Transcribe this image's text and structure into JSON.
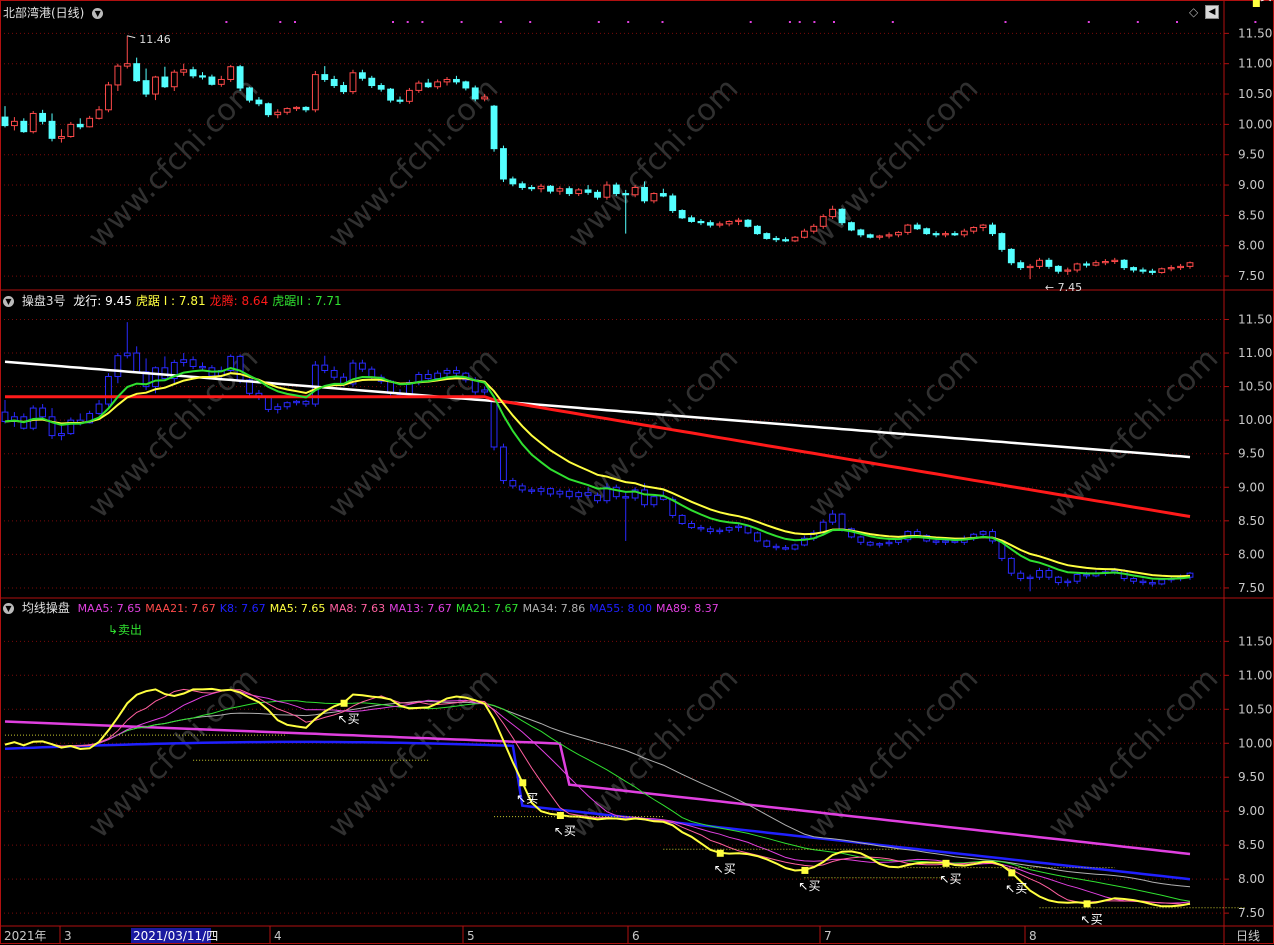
{
  "colors": {
    "bg": "#000000",
    "frame": "#b01010",
    "grid": "#7a0a0a",
    "axisText": "#c8c8c8",
    "upCandle": "#ff4a4a",
    "downCandle": "#54ffff",
    "blueCandle": "#2a2aff",
    "white": "#ffffff",
    "red": "#ff1a1a",
    "yellow": "#ffff40",
    "green": "#30e030",
    "magenta": "#e040e0",
    "blue": "#2020ff",
    "pink": "#ff60a0",
    "gray": "#b0b0b0"
  },
  "icons": [
    "collapse-icon",
    "diamond-icon",
    "scroll-left-icon"
  ],
  "panel1": {
    "title": "北部湾港(日线)",
    "yTicks": [
      "11.50",
      "11.00",
      "10.50",
      "10.00",
      "9.50",
      "9.00",
      "8.50",
      "8.00",
      "7.50"
    ],
    "ylim": [
      7.32,
      11.72
    ],
    "highLabel": "11.46",
    "lowLabel": "7.45"
  },
  "panel2": {
    "title": "操盘3号",
    "legend": [
      {
        "label": "龙行: 9.45",
        "color": "#ffffff"
      },
      {
        "label": "虎踞 I : 7.81",
        "color": "#ffff40"
      },
      {
        "label": "龙腾: 8.64",
        "color": "#ff1a1a"
      },
      {
        "label": "虎踞II : 7.71",
        "color": "#30e030"
      }
    ],
    "yTicks": [
      "11.50",
      "11.00",
      "10.50",
      "10.00",
      "9.50",
      "9.00",
      "8.50",
      "8.00",
      "7.50"
    ],
    "ylim": [
      7.38,
      11.82
    ]
  },
  "panel3": {
    "title": "均线操盘",
    "legend": [
      {
        "label": "MAA5: 7.65",
        "color": "#e040e0"
      },
      {
        "label": "MAA21: 7.67",
        "color": "#ff4a4a"
      },
      {
        "label": "K8: 7.67",
        "color": "#2020ff"
      },
      {
        "label": "MA5: 7.65",
        "color": "#ffff40"
      },
      {
        "label": "MA8: 7.63",
        "color": "#ff60a0"
      },
      {
        "label": "MA13: 7.67",
        "color": "#e040e0"
      },
      {
        "label": "MA21: 7.67",
        "color": "#30e030"
      },
      {
        "label": "MA34: 7.86",
        "color": "#b0b0b0"
      },
      {
        "label": "MA55: 8.00",
        "color": "#2020ff"
      },
      {
        "label": "MA89: 8.37",
        "color": "#e040e0"
      }
    ],
    "yTicks": [
      "11.50",
      "11.00",
      "10.50",
      "10.00",
      "9.50",
      "9.00",
      "8.50",
      "8.00",
      "7.50"
    ],
    "ylim": [
      7.34,
      12.02
    ],
    "sellLabel": "卖出",
    "buyLabel": "↖买"
  },
  "xAxis": {
    "labels": [
      {
        "text": "2021年",
        "x": 0
      },
      {
        "text": "3",
        "x": 60
      },
      {
        "text": "4",
        "x": 270
      },
      {
        "text": "5",
        "x": 463
      },
      {
        "text": "6",
        "x": 628
      },
      {
        "text": "7",
        "x": 820
      },
      {
        "text": "8",
        "x": 1025
      }
    ],
    "cursorDate": "2021/03/11/四",
    "period": "日线"
  },
  "watermark": "www.cfchi.com",
  "chart_data": {
    "type": "candlestick",
    "title": "北部湾港(日线)",
    "ohlc": [
      [
        10.12,
        10.3,
        9.95,
        9.98
      ],
      [
        9.98,
        10.12,
        9.9,
        10.05
      ],
      [
        10.05,
        10.1,
        9.86,
        9.88
      ],
      [
        9.88,
        10.22,
        9.85,
        10.18
      ],
      [
        10.18,
        10.24,
        10.0,
        10.05
      ],
      [
        10.05,
        10.18,
        9.72,
        9.77
      ],
      [
        9.77,
        9.92,
        9.7,
        9.8
      ],
      [
        9.8,
        10.04,
        9.78,
        10.0
      ],
      [
        10.0,
        10.1,
        9.92,
        9.96
      ],
      [
        9.96,
        10.14,
        9.95,
        10.1
      ],
      [
        10.1,
        10.3,
        10.08,
        10.24
      ],
      [
        10.24,
        10.7,
        10.2,
        10.65
      ],
      [
        10.65,
        11.0,
        10.55,
        10.96
      ],
      [
        10.96,
        11.46,
        10.92,
        11.0
      ],
      [
        11.0,
        11.1,
        10.7,
        10.72
      ],
      [
        10.72,
        10.92,
        10.45,
        10.5
      ],
      [
        10.5,
        10.8,
        10.4,
        10.78
      ],
      [
        10.78,
        10.95,
        10.6,
        10.62
      ],
      [
        10.62,
        10.9,
        10.55,
        10.86
      ],
      [
        10.86,
        11.0,
        10.8,
        10.9
      ],
      [
        10.9,
        10.95,
        10.76,
        10.8
      ],
      [
        10.8,
        10.86,
        10.74,
        10.78
      ],
      [
        10.78,
        10.82,
        10.64,
        10.66
      ],
      [
        10.66,
        10.8,
        10.62,
        10.74
      ],
      [
        10.74,
        10.98,
        10.7,
        10.95
      ],
      [
        10.95,
        10.98,
        10.55,
        10.6
      ],
      [
        10.6,
        10.62,
        10.36,
        10.4
      ],
      [
        10.4,
        10.45,
        10.3,
        10.34
      ],
      [
        10.34,
        10.36,
        10.12,
        10.16
      ],
      [
        10.16,
        10.25,
        10.1,
        10.2
      ],
      [
        10.2,
        10.28,
        10.16,
        10.26
      ],
      [
        10.26,
        10.3,
        10.22,
        10.28
      ],
      [
        10.28,
        10.3,
        10.2,
        10.24
      ],
      [
        10.24,
        10.88,
        10.2,
        10.82
      ],
      [
        10.82,
        10.96,
        10.7,
        10.74
      ],
      [
        10.74,
        10.8,
        10.6,
        10.64
      ],
      [
        10.64,
        10.7,
        10.5,
        10.54
      ],
      [
        10.54,
        10.9,
        10.5,
        10.85
      ],
      [
        10.85,
        10.9,
        10.72,
        10.76
      ],
      [
        10.76,
        10.8,
        10.6,
        10.64
      ],
      [
        10.64,
        10.68,
        10.54,
        10.58
      ],
      [
        10.58,
        10.6,
        10.36,
        10.4
      ],
      [
        10.4,
        10.46,
        10.34,
        10.38
      ],
      [
        10.38,
        10.6,
        10.34,
        10.56
      ],
      [
        10.56,
        10.72,
        10.52,
        10.68
      ],
      [
        10.68,
        10.75,
        10.6,
        10.62
      ],
      [
        10.62,
        10.74,
        10.58,
        10.7
      ],
      [
        10.7,
        10.78,
        10.64,
        10.74
      ],
      [
        10.74,
        10.8,
        10.66,
        10.7
      ],
      [
        10.7,
        10.72,
        10.56,
        10.6
      ],
      [
        10.6,
        10.64,
        10.38,
        10.42
      ],
      [
        10.42,
        10.5,
        10.38,
        10.45
      ],
      [
        10.3,
        10.32,
        9.55,
        9.6
      ],
      [
        9.6,
        9.65,
        9.05,
        9.1
      ],
      [
        9.1,
        9.14,
        8.98,
        9.02
      ],
      [
        9.02,
        9.06,
        8.92,
        8.96
      ],
      [
        8.96,
        9.0,
        8.9,
        8.94
      ],
      [
        8.94,
        9.02,
        8.88,
        8.98
      ],
      [
        8.98,
        9.0,
        8.86,
        8.9
      ],
      [
        8.9,
        8.98,
        8.84,
        8.94
      ],
      [
        8.94,
        8.98,
        8.82,
        8.86
      ],
      [
        8.86,
        8.95,
        8.82,
        8.92
      ],
      [
        8.92,
        9.0,
        8.84,
        8.88
      ],
      [
        8.88,
        8.92,
        8.76,
        8.8
      ],
      [
        8.8,
        9.06,
        8.76,
        9.0
      ],
      [
        9.0,
        9.04,
        8.82,
        8.86
      ],
      [
        8.86,
        8.92,
        8.2,
        8.84
      ],
      [
        8.84,
        9.0,
        8.8,
        8.96
      ],
      [
        8.96,
        9.06,
        8.7,
        8.74
      ],
      [
        8.74,
        8.88,
        8.7,
        8.86
      ],
      [
        8.86,
        8.94,
        8.8,
        8.82
      ],
      [
        8.82,
        8.86,
        8.54,
        8.58
      ],
      [
        8.58,
        8.6,
        8.44,
        8.46
      ],
      [
        8.46,
        8.5,
        8.38,
        8.4
      ],
      [
        8.4,
        8.44,
        8.34,
        8.38
      ],
      [
        8.38,
        8.42,
        8.3,
        8.34
      ],
      [
        8.34,
        8.4,
        8.3,
        8.36
      ],
      [
        8.36,
        8.42,
        8.32,
        8.4
      ],
      [
        8.4,
        8.46,
        8.34,
        8.42
      ],
      [
        8.42,
        8.44,
        8.3,
        8.32
      ],
      [
        8.32,
        8.34,
        8.18,
        8.2
      ],
      [
        8.2,
        8.22,
        8.1,
        8.12
      ],
      [
        8.12,
        8.16,
        8.06,
        8.1
      ],
      [
        8.1,
        8.14,
        8.06,
        8.08
      ],
      [
        8.08,
        8.16,
        8.06,
        8.14
      ],
      [
        8.14,
        8.28,
        8.12,
        8.24
      ],
      [
        8.24,
        8.36,
        8.2,
        8.32
      ],
      [
        8.32,
        8.52,
        8.28,
        8.48
      ],
      [
        8.48,
        8.66,
        8.44,
        8.6
      ],
      [
        8.6,
        8.62,
        8.34,
        8.38
      ],
      [
        8.38,
        8.4,
        8.24,
        8.26
      ],
      [
        8.26,
        8.28,
        8.14,
        8.18
      ],
      [
        8.18,
        8.2,
        8.12,
        8.14
      ],
      [
        8.14,
        8.18,
        8.1,
        8.16
      ],
      [
        8.16,
        8.22,
        8.12,
        8.18
      ],
      [
        8.18,
        8.24,
        8.14,
        8.22
      ],
      [
        8.22,
        8.36,
        8.18,
        8.34
      ],
      [
        8.34,
        8.38,
        8.26,
        8.28
      ],
      [
        8.28,
        8.3,
        8.18,
        8.2
      ],
      [
        8.2,
        8.24,
        8.14,
        8.18
      ],
      [
        8.18,
        8.24,
        8.14,
        8.2
      ],
      [
        8.2,
        8.24,
        8.16,
        8.18
      ],
      [
        8.18,
        8.28,
        8.14,
        8.24
      ],
      [
        8.24,
        8.32,
        8.2,
        8.3
      ],
      [
        8.3,
        8.36,
        8.24,
        8.34
      ],
      [
        8.34,
        8.38,
        8.16,
        8.2
      ],
      [
        8.2,
        8.22,
        7.9,
        7.94
      ],
      [
        7.94,
        7.96,
        7.68,
        7.72
      ],
      [
        7.72,
        7.76,
        7.6,
        7.64
      ],
      [
        7.64,
        7.7,
        7.45,
        7.66
      ],
      [
        7.66,
        7.8,
        7.62,
        7.76
      ],
      [
        7.76,
        7.8,
        7.62,
        7.66
      ],
      [
        7.66,
        7.68,
        7.54,
        7.58
      ],
      [
        7.58,
        7.64,
        7.52,
        7.6
      ],
      [
        7.6,
        7.72,
        7.56,
        7.7
      ],
      [
        7.7,
        7.74,
        7.64,
        7.68
      ],
      [
        7.68,
        7.76,
        7.66,
        7.72
      ],
      [
        7.72,
        7.78,
        7.68,
        7.74
      ],
      [
        7.74,
        7.8,
        7.7,
        7.76
      ],
      [
        7.76,
        7.78,
        7.6,
        7.64
      ],
      [
        7.64,
        7.66,
        7.56,
        7.6
      ],
      [
        7.6,
        7.64,
        7.54,
        7.58
      ],
      [
        7.58,
        7.62,
        7.52,
        7.56
      ],
      [
        7.56,
        7.64,
        7.54,
        7.62
      ],
      [
        7.62,
        7.68,
        7.58,
        7.64
      ],
      [
        7.64,
        7.7,
        7.6,
        7.66
      ],
      [
        7.66,
        7.74,
        7.62,
        7.72
      ]
    ],
    "ma": {
      "龙行": {
        "start": 10.87,
        "end": 9.45
      },
      "虎踞 I": {
        "end": 7.81
      },
      "龙腾": {
        "end": 8.64
      },
      "虎踞II": {
        "end": 7.71
      }
    },
    "buySignals": [
      36,
      55,
      59,
      76,
      85,
      100,
      107,
      115,
      133
    ],
    "sellSignals": [
      13
    ]
  }
}
